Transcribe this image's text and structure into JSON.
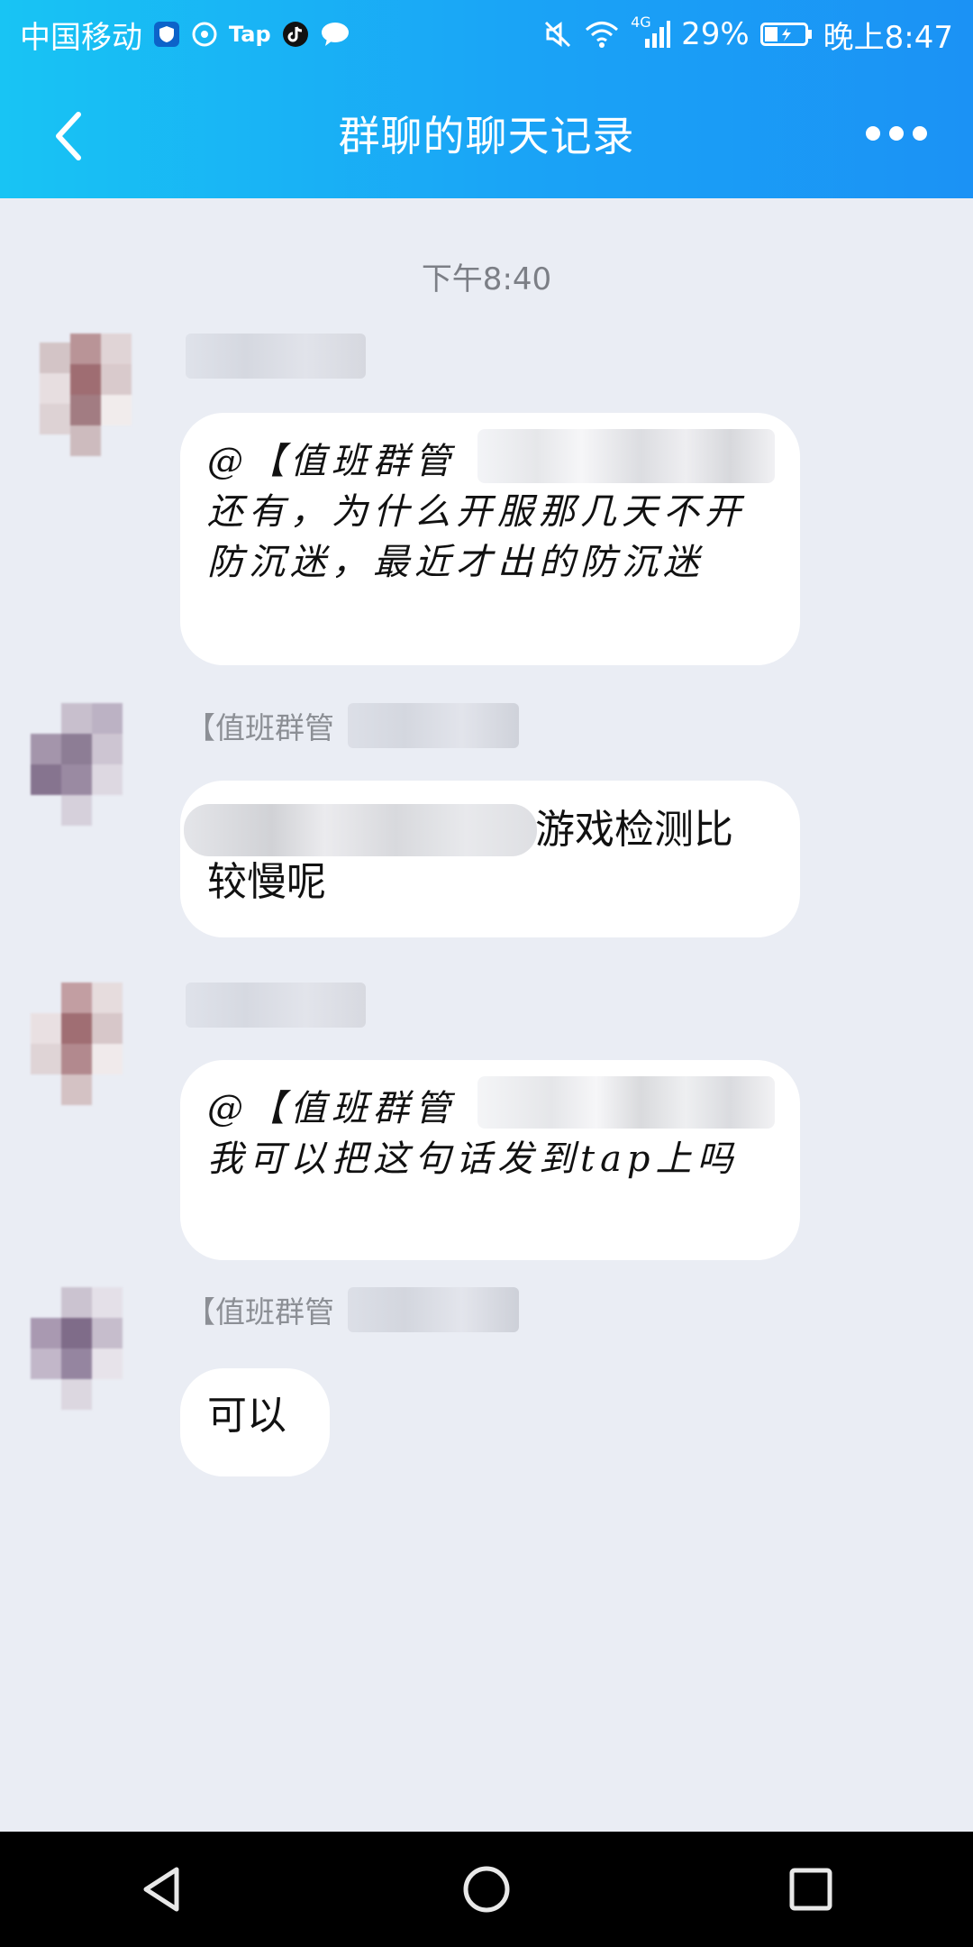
{
  "status_bar": {
    "carrier": "中国移动",
    "tap_label": "Tap",
    "network": "4G",
    "battery": "29%",
    "time": "晚上8:47"
  },
  "header": {
    "title": "群聊的聊天记录"
  },
  "chat": {
    "timestamp": "下午8:40",
    "messages": [
      {
        "sender_visible": "",
        "text": "@【值班群管\n还有，为什么开服那几天不开防沉迷，最近才出的防沉迷"
      },
      {
        "sender_visible": "【值班群管",
        "text": "游戏检测比\n较慢呢"
      },
      {
        "sender_visible": "",
        "text": "@【值班群管\n我可以把这句话发到tap上吗"
      },
      {
        "sender_visible": "【值班群管",
        "text": "可以"
      }
    ]
  },
  "colors": {
    "header_start": "#18c4f4",
    "header_end": "#1b92f5",
    "chat_bg": "#eaedf4",
    "bubble_bg": "#ffffff",
    "nav_bg": "#000000"
  }
}
